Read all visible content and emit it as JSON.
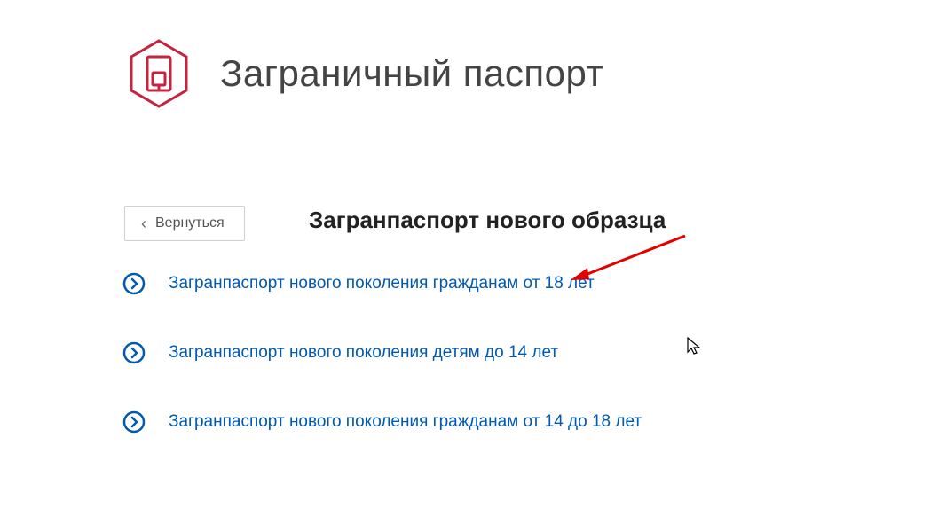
{
  "header": {
    "title": "Заграничный паспорт"
  },
  "back_button": {
    "label": "Вернуться"
  },
  "section": {
    "title": "Загранпаспорт нового образца"
  },
  "links": {
    "item1": "Загранпаспорт нового поколения гражданам от 18 лет",
    "item2": "Загранпаспорт нового поколения детям до 14 лет",
    "item3": "Загранпаспорт нового поколения гражданам от 14 до 18 лет"
  }
}
